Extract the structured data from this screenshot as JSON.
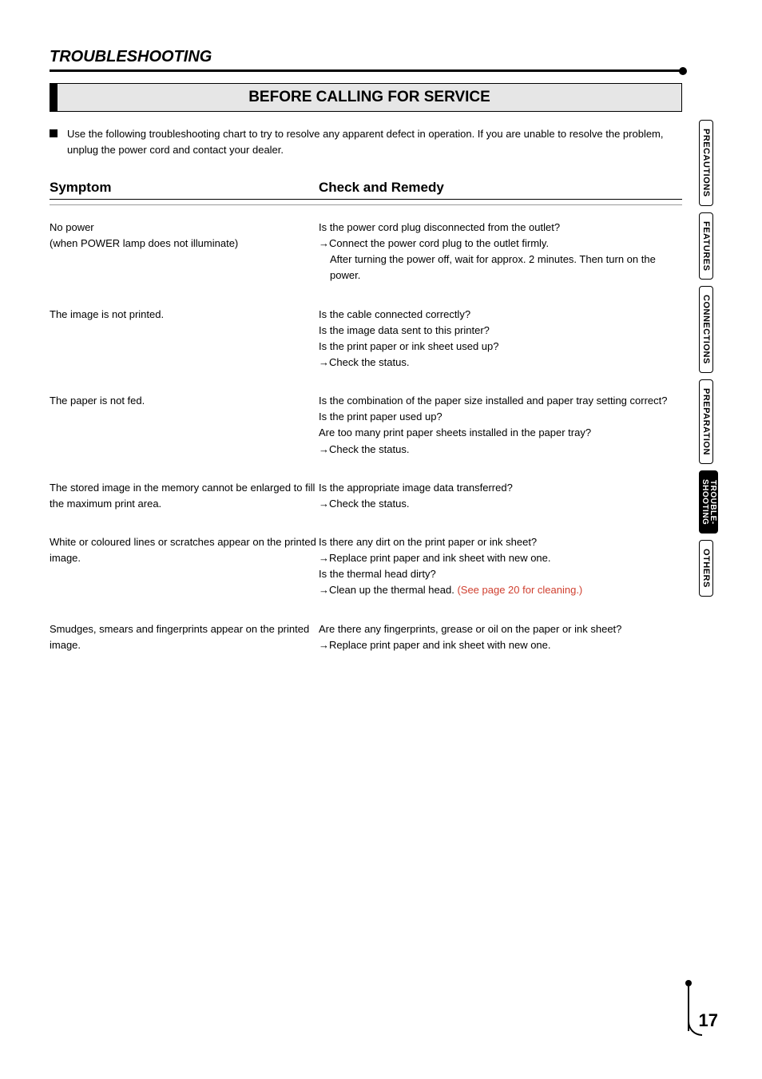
{
  "section_title": "TROUBLESHOOTING",
  "subtitle": "BEFORE CALLING FOR SERVICE",
  "intro": "Use the following troubleshooting chart to try to resolve any apparent defect in operation.  If you are unable to resolve the problem, unplug the power cord and contact your dealer.",
  "headers": {
    "symptom": "Symptom",
    "remedy": "Check and Remedy"
  },
  "rows": [
    {
      "symptom": [
        "No power",
        "(when POWER lamp does not illuminate)"
      ],
      "remedy": [
        {
          "text": "Is the power cord plug disconnected from the outlet?"
        },
        {
          "text": "Connect the power cord plug to the outlet firmly.",
          "arrow": true
        },
        {
          "text": "After turning the power off, wait for approx. 2 minutes. Then turn on the power.",
          "indent": true
        }
      ]
    },
    {
      "symptom": [
        "The image is not printed."
      ],
      "remedy": [
        {
          "text": "Is the cable connected correctly?"
        },
        {
          "text": "Is the image data sent to this printer?"
        },
        {
          "text": "Is the print paper or ink sheet used up?"
        },
        {
          "text": "Check the status.",
          "arrow": true
        }
      ]
    },
    {
      "symptom": [
        "The paper is not fed."
      ],
      "remedy": [
        {
          "text": "Is the combination of the paper size installed and paper tray setting correct?"
        },
        {
          "text": "Is the print paper used up?"
        },
        {
          "text": "Are too many print paper sheets installed in the paper tray?"
        },
        {
          "text": "Check the status.",
          "arrow": true
        }
      ]
    },
    {
      "symptom": [
        "The stored image in the memory cannot be enlarged to fill the maximum print area."
      ],
      "remedy": [
        {
          "text": "Is the appropriate image data transferred?"
        },
        {
          "text": "Check the status.",
          "arrow": true
        }
      ]
    },
    {
      "symptom": [
        "White or coloured lines or scratches appear on the printed image."
      ],
      "remedy": [
        {
          "text": "Is there any dirt on the print paper or ink sheet?"
        },
        {
          "text": "Replace print paper and ink sheet with new one.",
          "arrow": true
        },
        {
          "text": "Is the thermal head dirty?"
        },
        {
          "text": "Clean up the thermal head. ",
          "arrow": true,
          "link": "(See page 20 for cleaning.)"
        }
      ]
    },
    {
      "symptom": [
        "Smudges, smears and fingerprints appear on the printed image."
      ],
      "remedy": [
        {
          "text": "Are there any fingerprints, grease or oil on the paper or ink sheet?"
        },
        {
          "text": "Replace print paper and ink sheet with new one.",
          "arrow": true
        }
      ]
    }
  ],
  "tabs": [
    {
      "label": "PRECAUTIONS",
      "active": false
    },
    {
      "label": "FEATURES",
      "active": false
    },
    {
      "label": "CONNECTIONS",
      "active": false
    },
    {
      "label": "PREPARATION",
      "active": false
    },
    {
      "label": "TROUBLE-\nSHOOTING",
      "active": true,
      "two": true,
      "l1": "TROUBLE-",
      "l2": "SHOOTING"
    },
    {
      "label": "OTHERS",
      "active": false
    }
  ],
  "page_number": "17"
}
